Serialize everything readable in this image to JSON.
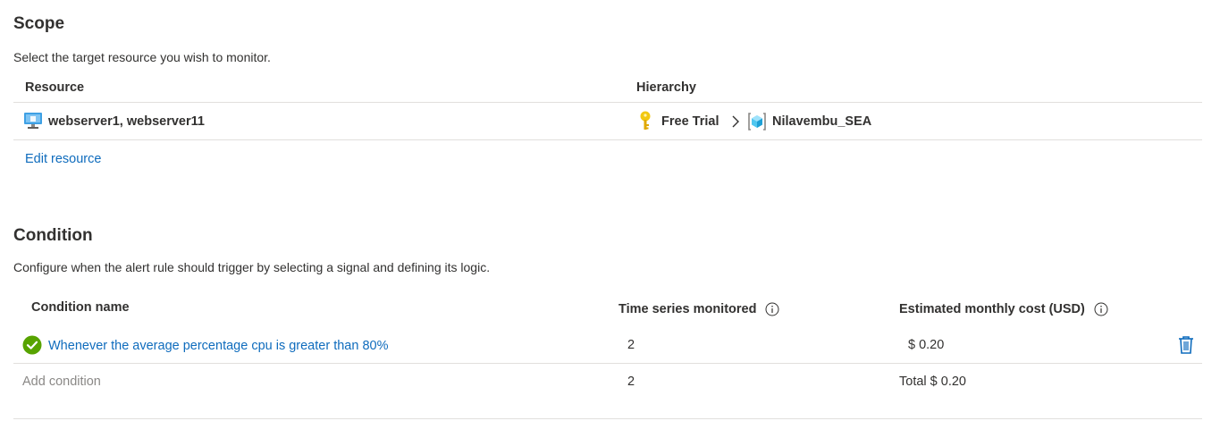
{
  "scope": {
    "title": "Scope",
    "description": "Select the target resource you wish to monitor.",
    "columns": {
      "resource": "Resource",
      "hierarchy": "Hierarchy"
    },
    "row": {
      "resource": "webserver1, webserver11",
      "hierarchy": [
        "Free Trial",
        "Nilavembu_SEA"
      ]
    },
    "edit_label": "Edit resource"
  },
  "condition": {
    "title": "Condition",
    "description": "Configure when the alert rule should trigger by selecting a signal and defining its logic.",
    "columns": {
      "name": "Condition name",
      "series": "Time series monitored",
      "cost": "Estimated monthly cost (USD)"
    },
    "rows": [
      {
        "name": "Whenever the average percentage cpu is greater than 80%",
        "series": "2",
        "cost": "$ 0.20"
      }
    ],
    "add_row": {
      "name": "Add condition",
      "series": "2",
      "cost": "Total $ 0.20"
    }
  },
  "colors": {
    "link": "#0f6cbd",
    "success": "#57a300",
    "key": "#f2c811",
    "border": "#e1dfdd"
  },
  "icons": {
    "resource": "virtual-machine-icon",
    "subscription": "key-icon",
    "resource_group": "resource-group-icon",
    "chevron": "chevron-right-icon",
    "info": "info-icon",
    "status": "success-check-icon",
    "delete": "trash-icon"
  }
}
